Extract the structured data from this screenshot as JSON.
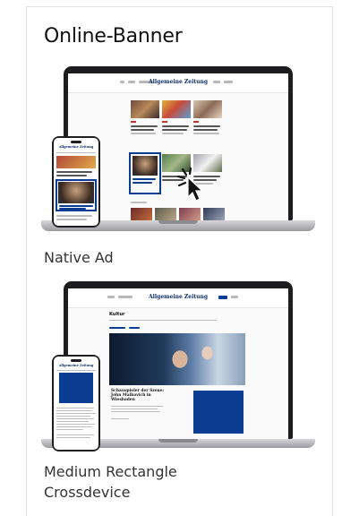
{
  "card": {
    "title": "Online-Banner",
    "items": [
      {
        "caption": "Native Ad"
      },
      {
        "caption_line1": "Medium Rectangle",
        "caption_line2": "Crossdevice"
      }
    ]
  },
  "mockup": {
    "site_logo": "Allgemeine Zeitung",
    "section_title": "Kultur",
    "hero_headline": "Schauspieler der Szene: John Malkovich in Wiesbaden",
    "ad_color": "#0a3d91",
    "cursor_icon": "pointer-click-icon"
  }
}
